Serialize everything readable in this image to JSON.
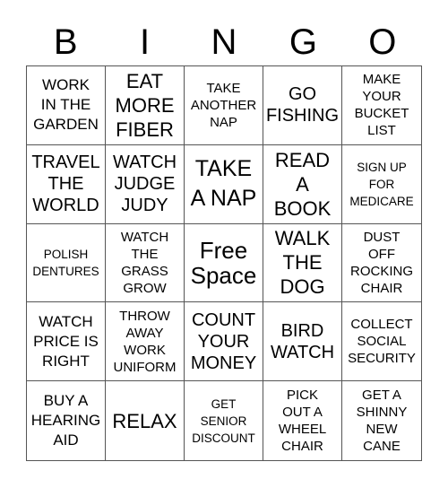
{
  "header": {
    "letters": [
      "B",
      "I",
      "N",
      "G",
      "O"
    ]
  },
  "cells": [
    {
      "text": "WORK\nIN THE\nGARDEN",
      "size": "s17"
    },
    {
      "text": "EAT\nMORE\nFIBER",
      "size": "s22"
    },
    {
      "text": "TAKE\nANOTHER\nNAP",
      "size": "s15"
    },
    {
      "text": "GO\nFISHING",
      "size": "s20"
    },
    {
      "text": "MAKE\nYOUR\nBUCKET\nLIST",
      "size": "s15"
    },
    {
      "text": "TRAVEL\nTHE\nWORLD",
      "size": "s20"
    },
    {
      "text": "WATCH\nJUDGE\nJUDY",
      "size": "s20"
    },
    {
      "text": "TAKE\nA NAP",
      "size": "s25"
    },
    {
      "text": "READ\nA\nBOOK",
      "size": "s22"
    },
    {
      "text": "SIGN UP\nFOR\nMEDICARE",
      "size": "s13"
    },
    {
      "text": "POLISH\nDENTURES",
      "size": "s13"
    },
    {
      "text": "WATCH\nTHE\nGRASS\nGROW",
      "size": "s15"
    },
    {
      "text": "Free\nSpace",
      "size": "s26",
      "free": true
    },
    {
      "text": "WALK\nTHE\nDOG",
      "size": "s22"
    },
    {
      "text": "DUST\nOFF\nROCKING\nCHAIR",
      "size": "s15"
    },
    {
      "text": "WATCH\nPRICE IS\nRIGHT",
      "size": "s17"
    },
    {
      "text": "THROW\nAWAY\nWORK\nUNIFORM",
      "size": "s15"
    },
    {
      "text": "COUNT\nYOUR\nMONEY",
      "size": "s20"
    },
    {
      "text": "BIRD\nWATCH",
      "size": "s20"
    },
    {
      "text": "COLLECT\nSOCIAL\nSECURITY",
      "size": "s15"
    },
    {
      "text": "BUY A\nHEARING\nAID",
      "size": "s17"
    },
    {
      "text": "RELAX",
      "size": "s22"
    },
    {
      "text": "GET\nSENIOR\nDISCOUNT",
      "size": "s13"
    },
    {
      "text": "PICK\nOUT A\nWHEEL\nCHAIR",
      "size": "s15"
    },
    {
      "text": "GET A\nSHINNY\nNEW\nCANE",
      "size": "s15"
    }
  ]
}
